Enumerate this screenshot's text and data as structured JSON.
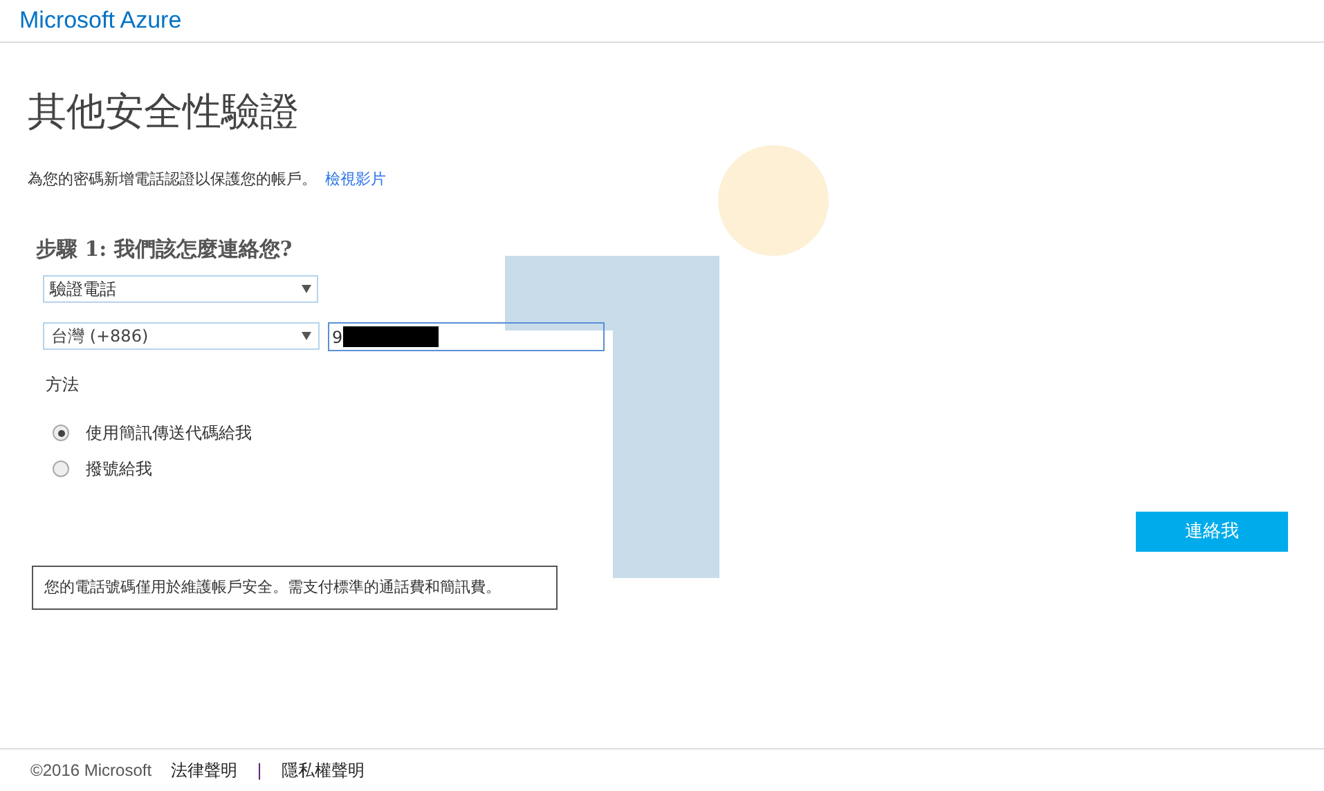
{
  "header": {
    "brand": "Microsoft Azure"
  },
  "page": {
    "title": "其他安全性驗證",
    "intro": "為您的密碼新增電話認證以保護您的帳戶。",
    "intro_link": "檢視影片"
  },
  "step": {
    "heading": "步驟 1: 我們該怎麼連絡您?",
    "method_select": {
      "value": "驗證電話"
    },
    "country_select": {
      "value": "台灣 (+886)"
    },
    "phone_field": {
      "value": "9",
      "focused": true
    },
    "method_label": "方法",
    "options": [
      {
        "label": "使用簡訊傳送代碼給我",
        "selected": true
      },
      {
        "label": "撥號給我",
        "selected": false
      }
    ],
    "submit": "連絡我"
  },
  "note": "您的電話號碼僅用於維護帳戶安全。需支付標準的通話費和簡訊費。",
  "footer": {
    "copyright": "©2016 Microsoft",
    "links": [
      "法律聲明",
      "隱私權聲明"
    ],
    "separator": "|"
  }
}
